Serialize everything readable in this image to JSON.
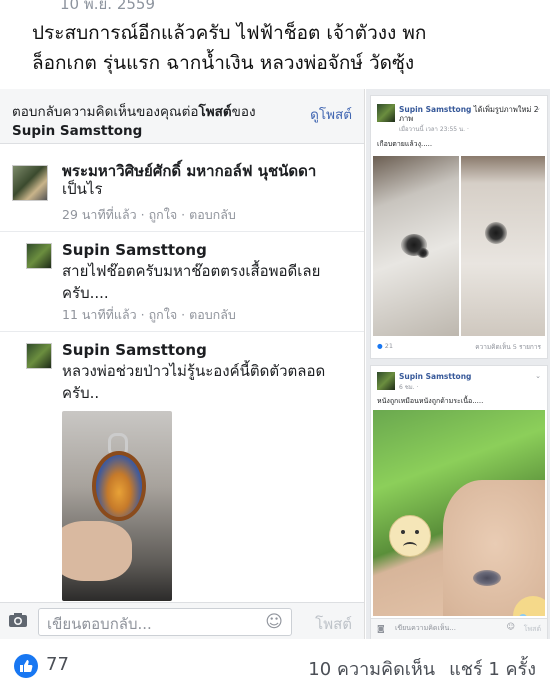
{
  "top_cut_text": "10 พ.ย. 2559",
  "caption": {
    "line1": "ประสบการณ์อีกแล้วครับ ไฟฟ้าช็อต เจ้าตัวงง พก",
    "line2": "ล็อกเกต รุ่นแรก ฉากน้ำเงิน หลวงพ่อจักษ์ วัดซุ้ง"
  },
  "reply_panel": {
    "header_prefix": "ตอบกลับความคิดเห็นของคุณต่อ",
    "header_bold": "โพสต์",
    "header_suffix": "ของ",
    "header_name": "Supin Samsttong",
    "view_post": "ดูโพสต์"
  },
  "comments": [
    {
      "name": "พระมหาวิศิษย์ศักดิ์ มหากอล์ฟ นุชนัดดา",
      "text": "เป็นไร",
      "time": "29 นาทีที่แล้ว",
      "like": "ถูกใจ",
      "reply": "ตอบกลับ"
    },
    {
      "name": "Supin Samsttong",
      "text_line1": "สายไฟช๊อตครับมหาช๊อตตรงเสื้อพอดีเลย",
      "text_line2": "ครับ....",
      "time": "11 นาทีที่แล้ว",
      "like": "ถูกใจ",
      "reply": "ตอบกลับ"
    },
    {
      "name": "Supin Samsttong",
      "text_line1": "หลวงพ่อช่วยป่าวไม่รู้นะองค์นี้ติดตัวตลอด",
      "text_line2": "ครับ.."
    }
  ],
  "reply_box": {
    "placeholder": "เขียนตอบกลับ...",
    "post_label": "โพสต์"
  },
  "post1": {
    "name": "Supin Samsttong",
    "action": "ได้เพิ่มรูปภาพใหม่ 2",
    "action2": "ภาพ",
    "time": "เมื่อวานนี้ เวลา 23:55 น. · ",
    "text": "เกือบตายแล้วงุ.....",
    "reactions": "21",
    "comments": "ความคิดเห็น 5 รายการ"
  },
  "post2": {
    "name": "Supin Samsttong",
    "time": "6 ชม. · ",
    "text": "หนังถูกเหมือนหนังถูกด้ามระเนื้อ.....",
    "reply_placeholder": "เขียนความคิดเห็น...",
    "post_label": "โพสต์"
  },
  "footer": {
    "likes": "77",
    "comments": "10 ความคิดเห็น",
    "shares": "แชร์ 1 ครั้ง"
  },
  "colors": {
    "facebook_blue": "#1877f2",
    "link_blue": "#4267b2"
  }
}
